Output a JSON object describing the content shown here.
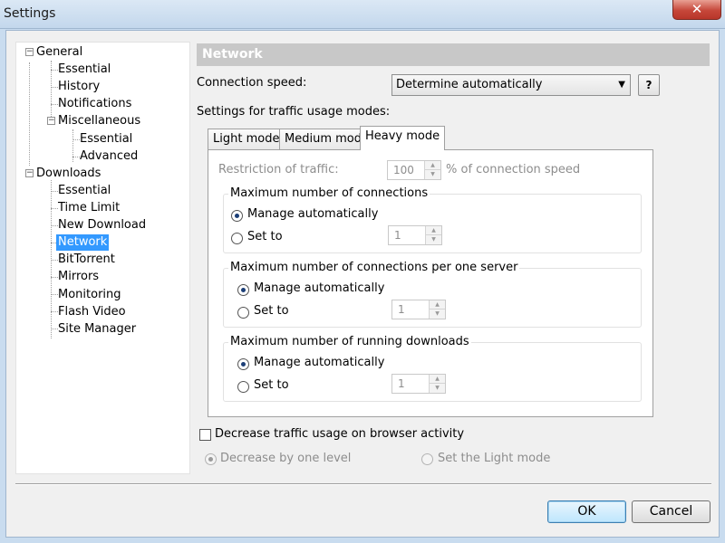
{
  "window": {
    "title": "Settings",
    "close_label": "✕"
  },
  "tree": {
    "items": [
      {
        "label": "General"
      },
      {
        "label": "Essential"
      },
      {
        "label": "History"
      },
      {
        "label": "Notifications"
      },
      {
        "label": "Miscellaneous"
      },
      {
        "label": "Essential"
      },
      {
        "label": "Advanced"
      },
      {
        "label": "Downloads"
      },
      {
        "label": "Essential"
      },
      {
        "label": "Time Limit"
      },
      {
        "label": "New Download"
      },
      {
        "label": "Network"
      },
      {
        "label": "BitTorrent"
      },
      {
        "label": "Mirrors"
      },
      {
        "label": "Monitoring"
      },
      {
        "label": "Flash Video"
      },
      {
        "label": "Site Manager"
      }
    ],
    "selected": "Network"
  },
  "panel": {
    "header": "Network",
    "connection_speed_label": "Connection speed:",
    "connection_speed_value": "Determine automatically",
    "help_label": "?",
    "modes_label": "Settings for traffic usage modes:",
    "tabs": [
      {
        "label": "Light mode"
      },
      {
        "label": "Medium mode"
      },
      {
        "label": "Heavy mode"
      }
    ],
    "active_tab": "Heavy mode",
    "restriction_label": "Restriction of traffic:",
    "restriction_value": "100",
    "restriction_unit": "% of connection speed",
    "groups": [
      {
        "title": "Maximum number of connections",
        "auto_label": "Manage automatically",
        "set_label": "Set to",
        "value": "1"
      },
      {
        "title": "Maximum number of connections per one server",
        "auto_label": "Manage automatically",
        "set_label": "Set to",
        "value": "1"
      },
      {
        "title": "Maximum number of running downloads",
        "auto_label": "Manage automatically",
        "set_label": "Set to",
        "value": "1"
      }
    ],
    "decrease_label": "Decrease traffic usage on browser activity",
    "decrease_checked": false,
    "decrease_one_level_label": "Decrease by one level",
    "light_mode_label": "Set the Light mode"
  },
  "buttons": {
    "ok": "OK",
    "cancel": "Cancel"
  },
  "colors": {
    "selection": "#3399ff",
    "header_bg": "#c8c8c8"
  }
}
